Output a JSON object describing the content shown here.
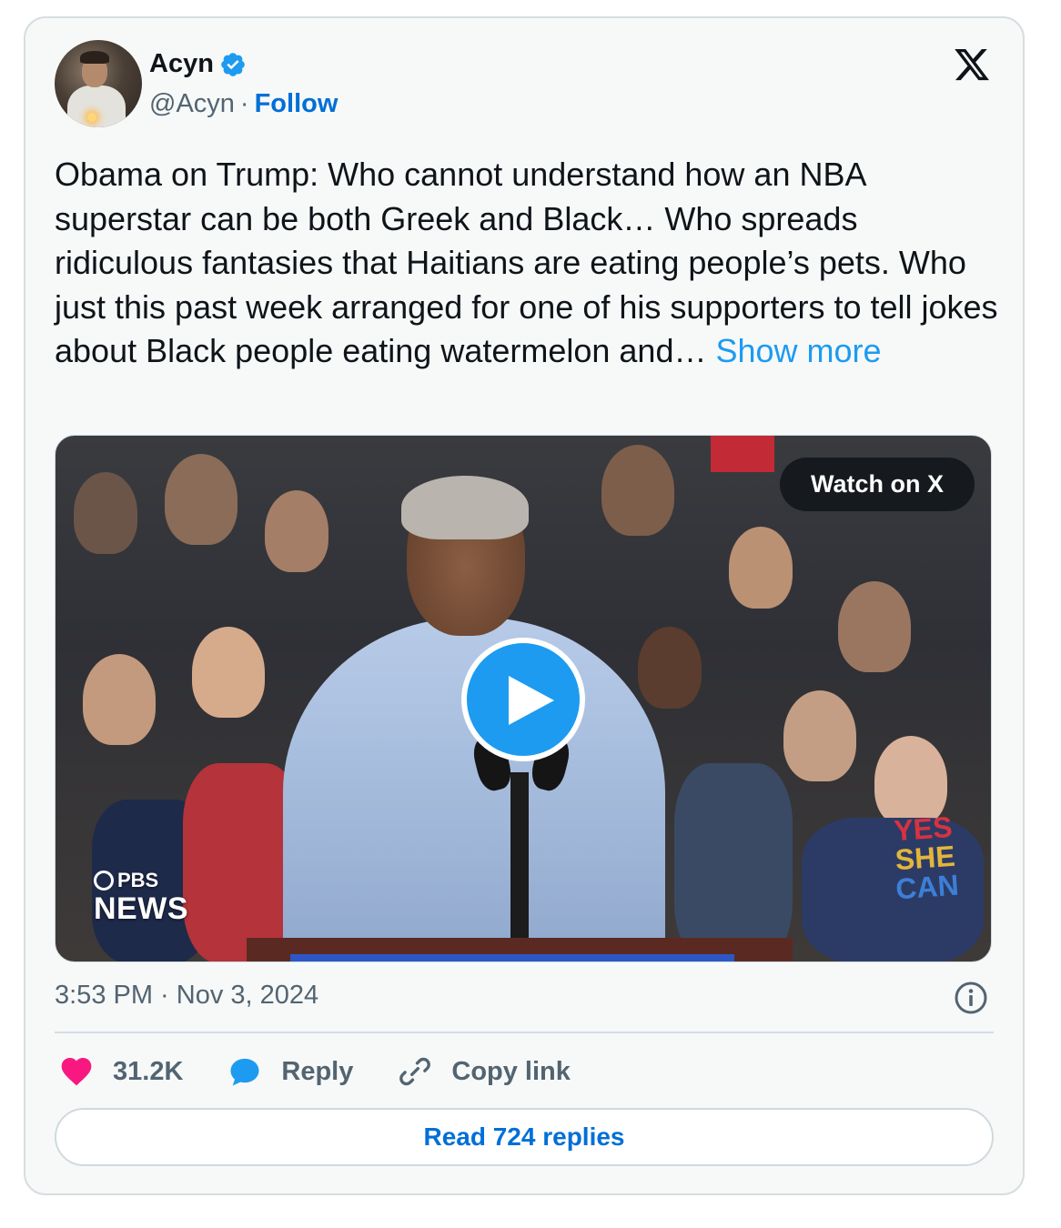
{
  "tweet": {
    "author": {
      "name": "Acyn",
      "handle": "@Acyn",
      "verified": true,
      "follow_label": "Follow",
      "separator": "·"
    },
    "text": "Obama on Trump: Who cannot understand how an NBA superstar can be both Greek and Black… Who spreads ridiculous fantasies that Haitians are eating people’s pets. Who just this past week arranged for one of his supporters to tell jokes about Black people eating watermelon and…",
    "show_more_label": "Show more",
    "media": {
      "watch_label": "Watch on X",
      "broadcaster_top": "PBS",
      "broadcaster_bottom": "NEWS",
      "sign_text": [
        "YES",
        "SHE",
        "CAN"
      ]
    },
    "timestamp": "3:53 PM · Nov 3, 2024",
    "actions": {
      "likes": "31.2K",
      "reply_label": "Reply",
      "copy_link_label": "Copy link"
    },
    "read_replies_label": "Read 724 replies"
  },
  "colors": {
    "accent": "#1d9bf0",
    "link": "#006fd6",
    "like": "#f91880",
    "muted": "#536471",
    "card_bg": "#f7f9f9"
  },
  "icons": [
    "verified-badge-icon",
    "x-logo-icon",
    "play-icon",
    "info-icon",
    "heart-icon",
    "reply-bubble-icon",
    "link-icon"
  ]
}
